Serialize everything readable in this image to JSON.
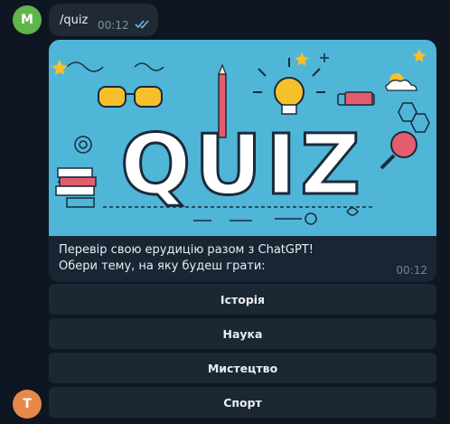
{
  "chat": {
    "user_avatar_letter": "M",
    "user_avatar_color": "#5fb54a",
    "bot_avatar_letter": "T",
    "bot_avatar_color": "#e7884b"
  },
  "user_message": {
    "text": "/quiz",
    "time": "00:12",
    "status_icon": "double-check-icon"
  },
  "bot_message": {
    "image_text": "QUIZ",
    "caption_line1": "Перевір свою ерудицію разом з ChatGPT!",
    "caption_line2": "Обери тему, на яку будеш грати:",
    "time": "00:12"
  },
  "keyboard": {
    "buttons": [
      "Історія",
      "Наука",
      "Мистецтво",
      "Спорт"
    ]
  },
  "colors": {
    "background": "#0e1621",
    "bubble": "#182533",
    "banner": "#4fb6d8",
    "accent_yellow": "#f6bf2c",
    "accent_red": "#e45d6e"
  }
}
